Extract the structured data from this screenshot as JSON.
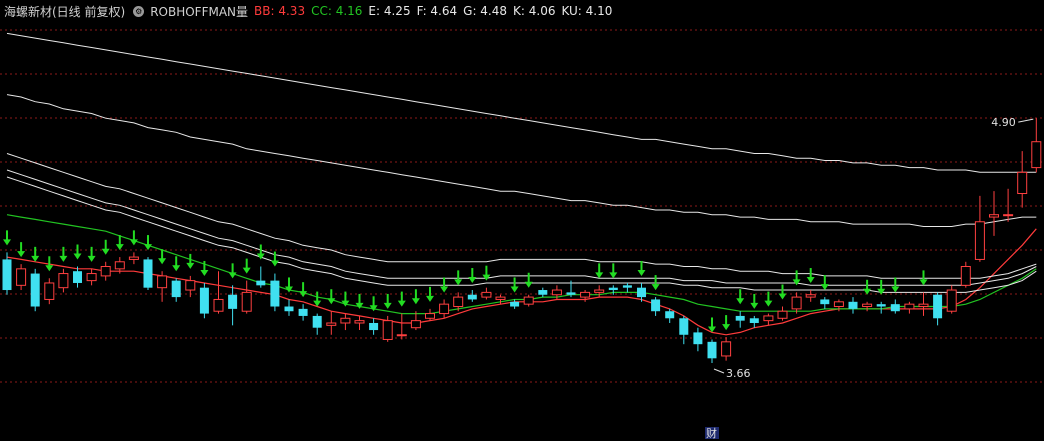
{
  "header": {
    "title": "海螺新材(日线 前复权)",
    "indicator": "ROBHOFFMAN量",
    "items": [
      {
        "label": "BB: 4.33",
        "color": "#ff3b3b"
      },
      {
        "label": "CC: 4.16",
        "color": "#22c322"
      },
      {
        "label": "E: 4.25",
        "color": "#e8e8e8"
      },
      {
        "label": "F: 4.64",
        "color": "#e8e8e8"
      },
      {
        "label": "G: 4.48",
        "color": "#e8e8e8"
      },
      {
        "label": "K: 4.06",
        "color": "#e8e8e8"
      },
      {
        "label": "KU: 4.10",
        "color": "#e8e8e8"
      }
    ]
  },
  "icons": {
    "settings": "gear-icon",
    "signal": "down-arrow-icon"
  },
  "colors": {
    "up": "#ff4040",
    "down": "#40e0f0",
    "arrow": "#22dd22",
    "bb": "#ff3b3b",
    "cc": "#22c322",
    "ma": "#e8e8e8",
    "grid": "#8b1a1a"
  },
  "annotations": {
    "high": "4.90",
    "low": "3.66",
    "event_tag": "财"
  },
  "chart_data": {
    "type": "candlestick",
    "y_range": [
      3.55,
      5.3
    ],
    "grid": true,
    "candles": [
      [
        4.3,
        4.17,
        4.33,
        4.15
      ],
      [
        4.19,
        4.26,
        4.28,
        4.17
      ],
      [
        4.24,
        4.1,
        4.26,
        4.08
      ],
      [
        4.13,
        4.2,
        4.22,
        4.11
      ],
      [
        4.18,
        4.24,
        4.26,
        4.16
      ],
      [
        4.25,
        4.2,
        4.27,
        4.18
      ],
      [
        4.21,
        4.24,
        4.26,
        4.19
      ],
      [
        4.23,
        4.27,
        4.29,
        4.21
      ],
      [
        4.26,
        4.29,
        4.31,
        4.24
      ],
      [
        4.3,
        4.31,
        4.33,
        4.28
      ],
      [
        4.3,
        4.18,
        4.31,
        4.17
      ],
      [
        4.18,
        4.23,
        4.25,
        4.12
      ],
      [
        4.21,
        4.14,
        4.22,
        4.12
      ],
      [
        4.17,
        4.21,
        4.23,
        4.14
      ],
      [
        4.18,
        4.07,
        4.2,
        4.05
      ],
      [
        4.08,
        4.13,
        4.25,
        4.07
      ],
      [
        4.15,
        4.09,
        4.19,
        4.02
      ],
      [
        4.08,
        4.16,
        4.21,
        4.07
      ],
      [
        4.21,
        4.19,
        4.27,
        4.18
      ],
      [
        4.21,
        4.1,
        4.24,
        4.08
      ],
      [
        4.1,
        4.08,
        4.13,
        4.06
      ],
      [
        4.09,
        4.06,
        4.11,
        4.04
      ],
      [
        4.06,
        4.01,
        4.07,
        3.98
      ],
      [
        4.02,
        4.03,
        4.08,
        3.98
      ],
      [
        4.03,
        4.05,
        4.07,
        4.0
      ],
      [
        4.03,
        4.04,
        4.06,
        4.0
      ],
      [
        4.03,
        4.0,
        4.05,
        3.98
      ],
      [
        3.96,
        4.04,
        4.06,
        3.95
      ],
      [
        3.98,
        3.98,
        4.07,
        3.96
      ],
      [
        4.01,
        4.04,
        4.08,
        4.0
      ],
      [
        4.05,
        4.07,
        4.09,
        4.04
      ],
      [
        4.07,
        4.11,
        4.13,
        4.05
      ],
      [
        4.1,
        4.14,
        4.16,
        4.08
      ],
      [
        4.15,
        4.13,
        4.17,
        4.12
      ],
      [
        4.14,
        4.16,
        4.18,
        4.13
      ],
      [
        4.13,
        4.14,
        4.15,
        4.11
      ],
      [
        4.12,
        4.1,
        4.13,
        4.09
      ],
      [
        4.11,
        4.14,
        4.15,
        4.1
      ],
      [
        4.17,
        4.15,
        4.18,
        4.14
      ],
      [
        4.15,
        4.17,
        4.19,
        4.13
      ],
      [
        4.16,
        4.15,
        4.21,
        4.14
      ],
      [
        4.14,
        4.16,
        4.17,
        4.12
      ],
      [
        4.16,
        4.17,
        4.19,
        4.14
      ],
      [
        4.18,
        4.17,
        4.19,
        4.15
      ],
      [
        4.19,
        4.18,
        4.2,
        4.16
      ],
      [
        4.18,
        4.14,
        4.2,
        4.12
      ],
      [
        4.13,
        4.08,
        4.14,
        4.06
      ],
      [
        4.08,
        4.05,
        4.09,
        4.03
      ],
      [
        4.05,
        3.98,
        4.06,
        3.94
      ],
      [
        3.99,
        3.94,
        4.01,
        3.91
      ],
      [
        3.95,
        3.88,
        3.96,
        3.86
      ],
      [
        3.89,
        3.95,
        3.97,
        3.87
      ],
      [
        4.06,
        4.04,
        4.08,
        4.01
      ],
      [
        4.05,
        4.03,
        4.06,
        4.01
      ],
      [
        4.04,
        4.06,
        4.07,
        4.02
      ],
      [
        4.05,
        4.08,
        4.1,
        4.04
      ],
      [
        4.09,
        4.14,
        4.16,
        4.07
      ],
      [
        4.14,
        4.15,
        4.17,
        4.12
      ],
      [
        4.13,
        4.11,
        4.14,
        4.09
      ],
      [
        4.1,
        4.12,
        4.13,
        4.08
      ],
      [
        4.12,
        4.09,
        4.14,
        4.07
      ],
      [
        4.1,
        4.11,
        4.12,
        4.08
      ],
      [
        4.11,
        4.1,
        4.12,
        4.07
      ],
      [
        4.11,
        4.08,
        4.13,
        4.07
      ],
      [
        4.09,
        4.11,
        4.12,
        4.07
      ],
      [
        4.1,
        4.11,
        4.16,
        4.06
      ],
      [
        4.15,
        4.05,
        4.16,
        4.02
      ],
      [
        4.08,
        4.17,
        4.19,
        4.07
      ],
      [
        4.19,
        4.27,
        4.29,
        4.18
      ],
      [
        4.3,
        4.46,
        4.57,
        4.29
      ],
      [
        4.48,
        4.49,
        4.59,
        4.4
      ],
      [
        4.49,
        4.49,
        4.6,
        4.46
      ],
      [
        4.58,
        4.67,
        4.76,
        4.52
      ],
      [
        4.69,
        4.8,
        4.9,
        4.67
      ]
    ],
    "series": [
      {
        "name": "BB",
        "values": [
          4.31,
          4.3,
          4.29,
          4.28,
          4.27,
          4.26,
          4.26,
          4.25,
          4.25,
          4.25,
          4.24,
          4.23,
          4.22,
          4.21,
          4.2,
          4.19,
          4.18,
          4.17,
          4.16,
          4.15,
          4.13,
          4.12,
          4.1,
          4.08,
          4.07,
          4.06,
          4.05,
          4.04,
          4.03,
          4.03,
          4.04,
          4.05,
          4.07,
          4.09,
          4.1,
          4.11,
          4.12,
          4.12,
          4.12,
          4.13,
          4.13,
          4.13,
          4.14,
          4.14,
          4.14,
          4.13,
          4.11,
          4.09,
          4.06,
          4.02,
          3.99,
          3.98,
          3.99,
          4.01,
          4.02,
          4.03,
          4.05,
          4.07,
          4.08,
          4.09,
          4.09,
          4.09,
          4.09,
          4.09,
          4.09,
          4.09,
          4.09,
          4.1,
          4.13,
          4.18,
          4.24,
          4.3,
          4.36,
          4.43
        ]
      },
      {
        "name": "CC",
        "values": [
          4.49,
          4.48,
          4.47,
          4.46,
          4.45,
          4.44,
          4.43,
          4.42,
          4.4,
          4.38,
          4.36,
          4.34,
          4.32,
          4.3,
          4.28,
          4.26,
          4.24,
          4.22,
          4.2,
          4.19,
          4.17,
          4.16,
          4.14,
          4.13,
          4.11,
          4.1,
          4.09,
          4.08,
          4.07,
          4.07,
          4.07,
          4.08,
          4.09,
          4.1,
          4.11,
          4.12,
          4.13,
          4.13,
          4.14,
          4.14,
          4.15,
          4.15,
          4.15,
          4.16,
          4.16,
          4.16,
          4.15,
          4.14,
          4.13,
          4.11,
          4.1,
          4.09,
          4.08,
          4.08,
          4.08,
          4.08,
          4.08,
          4.08,
          4.09,
          4.09,
          4.09,
          4.09,
          4.09,
          4.1,
          4.1,
          4.1,
          4.1,
          4.1,
          4.11,
          4.13,
          4.16,
          4.19,
          4.22,
          4.26
        ]
      },
      {
        "name": "E",
        "values": [
          4.65,
          4.63,
          4.61,
          4.59,
          4.57,
          4.55,
          4.53,
          4.51,
          4.5,
          4.48,
          4.46,
          4.44,
          4.42,
          4.4,
          4.38,
          4.36,
          4.35,
          4.33,
          4.31,
          4.29,
          4.28,
          4.26,
          4.25,
          4.24,
          4.22,
          4.21,
          4.2,
          4.19,
          4.19,
          4.19,
          4.19,
          4.19,
          4.19,
          4.19,
          4.2,
          4.2,
          4.2,
          4.2,
          4.2,
          4.2,
          4.2,
          4.2,
          4.2,
          4.2,
          4.2,
          4.2,
          4.2,
          4.2,
          4.19,
          4.19,
          4.18,
          4.18,
          4.18,
          4.17,
          4.17,
          4.17,
          4.17,
          4.17,
          4.17,
          4.17,
          4.17,
          4.17,
          4.16,
          4.16,
          4.16,
          4.16,
          4.16,
          4.16,
          4.16,
          4.17,
          4.18,
          4.19,
          4.21,
          4.25
        ]
      },
      {
        "name": "G",
        "values": [
          4.68,
          4.66,
          4.64,
          4.62,
          4.6,
          4.58,
          4.56,
          4.54,
          4.53,
          4.51,
          4.49,
          4.47,
          4.45,
          4.43,
          4.41,
          4.39,
          4.38,
          4.36,
          4.34,
          4.32,
          4.31,
          4.29,
          4.28,
          4.27,
          4.25,
          4.24,
          4.23,
          4.22,
          4.22,
          4.22,
          4.22,
          4.22,
          4.22,
          4.22,
          4.22,
          4.23,
          4.23,
          4.23,
          4.23,
          4.23,
          4.23,
          4.23,
          4.22,
          4.22,
          4.22,
          4.22,
          4.22,
          4.22,
          4.21,
          4.21,
          4.21,
          4.2,
          4.2,
          4.2,
          4.2,
          4.2,
          4.2,
          4.19,
          4.19,
          4.19,
          4.19,
          4.19,
          4.19,
          4.19,
          4.19,
          4.19,
          4.19,
          4.19,
          4.19,
          4.2,
          4.21,
          4.22,
          4.24,
          4.27
        ]
      },
      {
        "name": "F",
        "values": [
          5.0,
          4.99,
          4.97,
          4.96,
          4.94,
          4.93,
          4.92,
          4.9,
          4.89,
          4.88,
          4.86,
          4.85,
          4.84,
          4.82,
          4.81,
          4.8,
          4.79,
          4.77,
          4.76,
          4.75,
          4.74,
          4.73,
          4.72,
          4.71,
          4.7,
          4.69,
          4.68,
          4.67,
          4.66,
          4.65,
          4.64,
          4.63,
          4.62,
          4.61,
          4.6,
          4.59,
          4.59,
          4.58,
          4.57,
          4.56,
          4.55,
          4.55,
          4.54,
          4.53,
          4.53,
          4.52,
          4.51,
          4.51,
          4.5,
          4.5,
          4.49,
          4.49,
          4.48,
          4.48,
          4.47,
          4.47,
          4.47,
          4.46,
          4.46,
          4.46,
          4.45,
          4.45,
          4.45,
          4.45,
          4.45,
          4.44,
          4.44,
          4.44,
          4.45,
          4.45,
          4.46,
          4.47,
          4.48,
          4.48
        ]
      },
      {
        "name": "K",
        "values": [
          5.26,
          5.25,
          5.24,
          5.23,
          5.22,
          5.21,
          5.2,
          5.19,
          5.18,
          5.17,
          5.16,
          5.15,
          5.14,
          5.13,
          5.12,
          5.11,
          5.1,
          5.09,
          5.08,
          5.07,
          5.06,
          5.05,
          5.04,
          5.03,
          5.02,
          5.01,
          5.0,
          4.99,
          4.98,
          4.97,
          4.96,
          4.95,
          4.94,
          4.93,
          4.92,
          4.91,
          4.9,
          4.89,
          4.88,
          4.87,
          4.86,
          4.85,
          4.84,
          4.83,
          4.82,
          4.81,
          4.81,
          4.8,
          4.79,
          4.78,
          4.77,
          4.77,
          4.76,
          4.75,
          4.75,
          4.74,
          4.73,
          4.73,
          4.72,
          4.72,
          4.71,
          4.71,
          4.7,
          4.7,
          4.69,
          4.69,
          4.68,
          4.68,
          4.68,
          4.67,
          4.67,
          4.67,
          4.67,
          4.67
        ]
      },
      {
        "name": "KU",
        "values": [
          4.75,
          4.73,
          4.71,
          4.69,
          4.67,
          4.65,
          4.63,
          4.61,
          4.6,
          4.58,
          4.56,
          4.54,
          4.52,
          4.5,
          4.48,
          4.46,
          4.45,
          4.43,
          4.41,
          4.39,
          4.38,
          4.36,
          4.35,
          4.34,
          4.32,
          4.31,
          4.3,
          4.29,
          4.29,
          4.29,
          4.29,
          4.29,
          4.29,
          4.29,
          4.29,
          4.3,
          4.3,
          4.3,
          4.3,
          4.3,
          4.3,
          4.3,
          4.29,
          4.29,
          4.29,
          4.29,
          4.28,
          4.28,
          4.27,
          4.27,
          4.26,
          4.26,
          4.25,
          4.25,
          4.25,
          4.24,
          4.24,
          4.24,
          4.23,
          4.23,
          4.23,
          4.23,
          4.22,
          4.22,
          4.22,
          4.22,
          4.22,
          4.22,
          4.22,
          4.22,
          4.23,
          4.24,
          4.26,
          4.28
        ]
      }
    ],
    "signal_arrows": [
      0,
      1,
      2,
      3,
      4,
      5,
      6,
      7,
      8,
      9,
      10,
      11,
      12,
      13,
      14,
      16,
      17,
      18,
      19,
      20,
      21,
      22,
      23,
      24,
      25,
      26,
      27,
      28,
      29,
      30,
      31,
      32,
      33,
      34,
      36,
      37,
      42,
      43,
      45,
      46,
      50,
      51,
      52,
      53,
      54,
      55,
      56,
      57,
      58,
      61,
      62,
      63,
      65
    ]
  }
}
